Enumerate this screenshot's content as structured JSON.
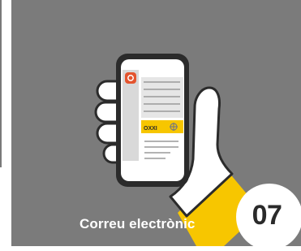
{
  "card": {
    "caption": "Correu electrònic",
    "step_number": "07"
  },
  "phone": {
    "app_icon": "email-at-icon",
    "ad_badge_text": "OXXI"
  },
  "colors": {
    "background": "#7b7b7b",
    "accent_yellow": "#f7c600",
    "app_icon_red": "#e4542e",
    "phone_frame": "#2b2b2b"
  }
}
